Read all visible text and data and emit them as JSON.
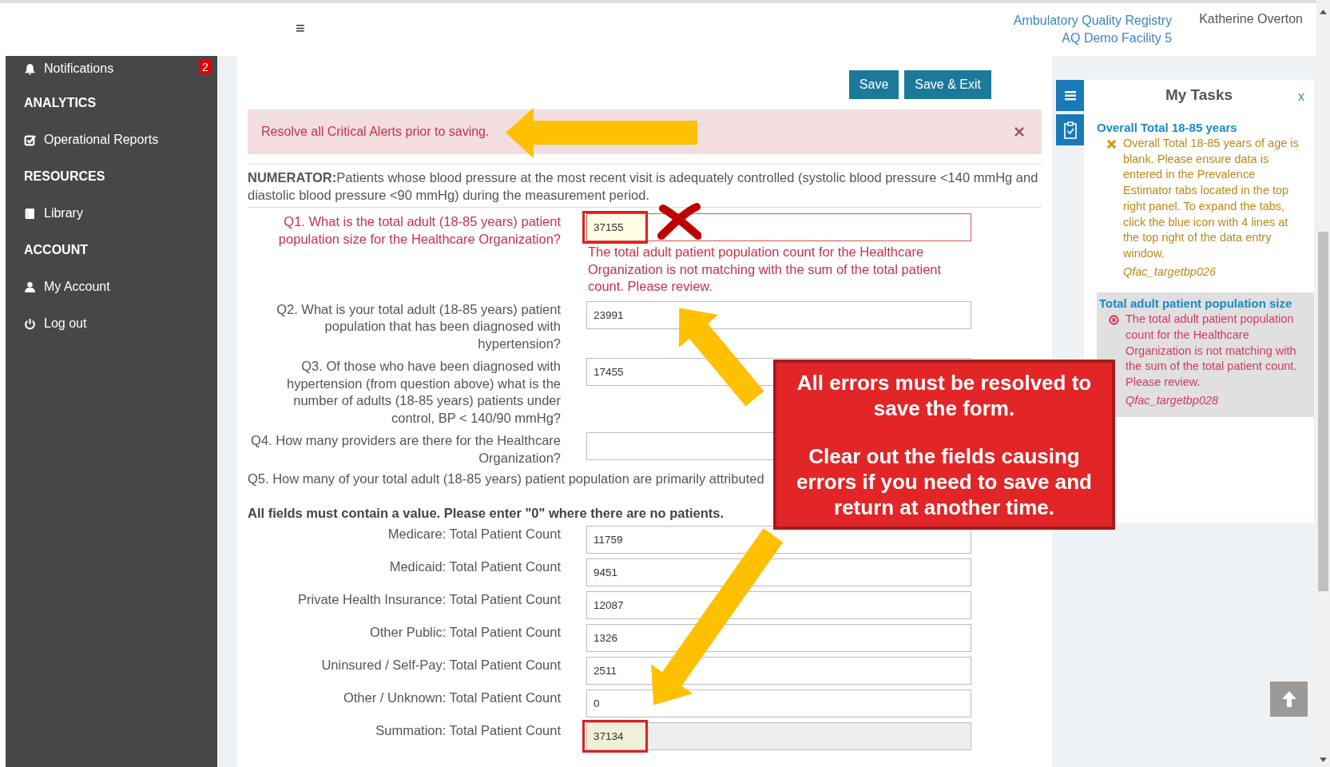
{
  "header": {
    "menu": "≡",
    "registry": "Ambulatory Quality Registry",
    "facility": "AQ Demo Facility 5",
    "user": "Katherine Overton"
  },
  "sidebar": {
    "items": [
      {
        "kind": "bell",
        "label": "Notifications",
        "badge": "2"
      },
      {
        "kind": "heading",
        "label": "ANALYTICS"
      },
      {
        "kind": "check",
        "label": "Operational Reports"
      },
      {
        "kind": "heading",
        "label": "RESOURCES"
      },
      {
        "kind": "book",
        "label": "Library"
      },
      {
        "kind": "heading",
        "label": "ACCOUNT"
      },
      {
        "kind": "user",
        "label": "My Account"
      },
      {
        "kind": "power",
        "label": "Log out"
      }
    ]
  },
  "toolbar": {
    "buttons": [
      "Save",
      "Save & Exit"
    ]
  },
  "alert": {
    "message": "Resolve all Critical Alerts prior to saving.",
    "close": "×"
  },
  "numerator": "**NUMERATOR:**Patients whose blood pressure at the most recent visit is adequately controlled (systolic blood pressure <140 mmHg and diastolic blood pressure <90 mmHg) during the measurement period.",
  "questions": [
    {
      "label": "Q1. What is the total adult (18-85 years) patient population size for the Healthcare Organization?",
      "value": "37155",
      "invalid": true,
      "highlighted": true,
      "error": "The total adult patient population count for the Healthcare Organization is not matching with the sum of the total patient count. Please review."
    },
    {
      "label": "Q2. What is your total adult (18-85 years) patient population that has been diagnosed with hypertension?",
      "value": "23991",
      "invalid": false,
      "highlighted": false
    },
    {
      "label": "Q3. Of those who have been diagnosed with hypertension (from question above) what is the number of adults (18-85 years) patients under control, BP < 140/90 mmHg?",
      "value": "17455",
      "invalid": false,
      "highlighted": false
    },
    {
      "label": "Q4. How many providers are there for the Healthcare Organization?",
      "invalid": false,
      "highlighted": false
    }
  ],
  "q5": {
    "text": "Q5. How many of your total adult (18-85 years) patient population are primarily attributed",
    "instruction": "All fields must contain a value. Please enter \"0\" where there are no patients.",
    "counts": [
      {
        "label": "Medicare: Total Patient Count",
        "value": "11759",
        "readonly": false,
        "highlighted": false
      },
      {
        "label": "Medicaid: Total Patient Count",
        "value": "9451",
        "readonly": false,
        "highlighted": false
      },
      {
        "label": "Private Health Insurance: Total Patient Count",
        "value": "12087",
        "readonly": false,
        "highlighted": false
      },
      {
        "label": "Other Public: Total Patient Count",
        "value": "1326",
        "readonly": false,
        "highlighted": false
      },
      {
        "label": "Uninsured / Self-Pay: Total Patient Count",
        "value": "2511",
        "readonly": false,
        "highlighted": false
      },
      {
        "label": "Other / Unknown: Total Patient Count",
        "value": "0",
        "readonly": false,
        "highlighted": false
      },
      {
        "label": "Summation: Total Patient Count",
        "value": "37134",
        "readonly": true,
        "highlighted": true
      }
    ]
  },
  "tasks": {
    "title": "My Tasks",
    "close": "x",
    "items": [
      {
        "heading": "Overall Total 18-85 years",
        "kind": "warning",
        "selected": false,
        "message": "Overall Total 18-85 years of age is blank. Please ensure data is entered in the Prevalence Estimator tabs located in the top right panel. To expand the tabs, click the blue icon with 4 lines at the top right of the data entry window.",
        "code": "Qfac_targetbp026"
      },
      {
        "heading": "Total adult patient population size",
        "kind": "error",
        "selected": true,
        "message": "The total adult patient population count for the Healthcare Organization is not matching with the sum of the total patient count. Please review.",
        "code": "Qfac_targetbp028"
      }
    ]
  },
  "callout": {
    "lines": [
      "All errors must be resolved to save the form.",
      "Clear out the fields causing errors if you need to save and return at another time."
    ]
  }
}
